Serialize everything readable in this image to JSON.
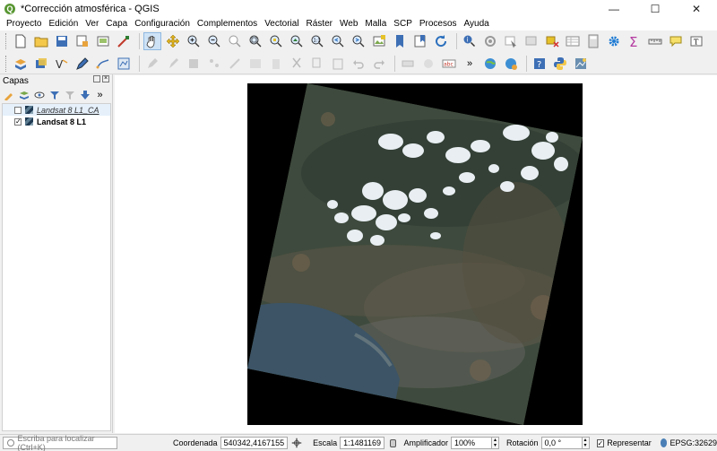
{
  "window": {
    "title": "*Corrección atmosférica - QGIS",
    "app_icon_letter": "Q",
    "controls": [
      "—",
      "☐",
      "✕"
    ]
  },
  "menu": [
    "Proyecto",
    "Edición",
    "Ver",
    "Capa",
    "Configuración",
    "Complementos",
    "Vectorial",
    "Ráster",
    "Web",
    "Malla",
    "SCP",
    "Procesos",
    "Ayuda"
  ],
  "toolbar1_overflow": "»",
  "toolbar2_overflow": "»",
  "layers_panel": {
    "title": "Capas",
    "toolbar_overflow": "»",
    "layers": [
      {
        "name": "Landsat 8 L1_CA",
        "checked": false,
        "checkmark": ""
      },
      {
        "name": "Landsat 8 L1",
        "checked": true,
        "checkmark": "✓"
      }
    ]
  },
  "statusbar": {
    "locator_placeholder": "Escriba para localizar (Ctrl+K)",
    "coordinate_label": "Coordenada",
    "coordinate_value": "540342,4167155",
    "scale_label": "Escala",
    "scale_value": "1:1481169",
    "magnifier_label": "Amplificador",
    "magnifier_value": "100%",
    "rotation_label": "Rotación",
    "rotation_value": "0,0 °",
    "render_label": "Representar",
    "render_checked": "✓",
    "crs_value": "EPSG:32629"
  },
  "colors": {
    "qgis_green": "#589632",
    "raster_background": "#000000",
    "land": "#3e4a3d",
    "sea": "#3c5466",
    "clouds": "#e8eef2"
  }
}
